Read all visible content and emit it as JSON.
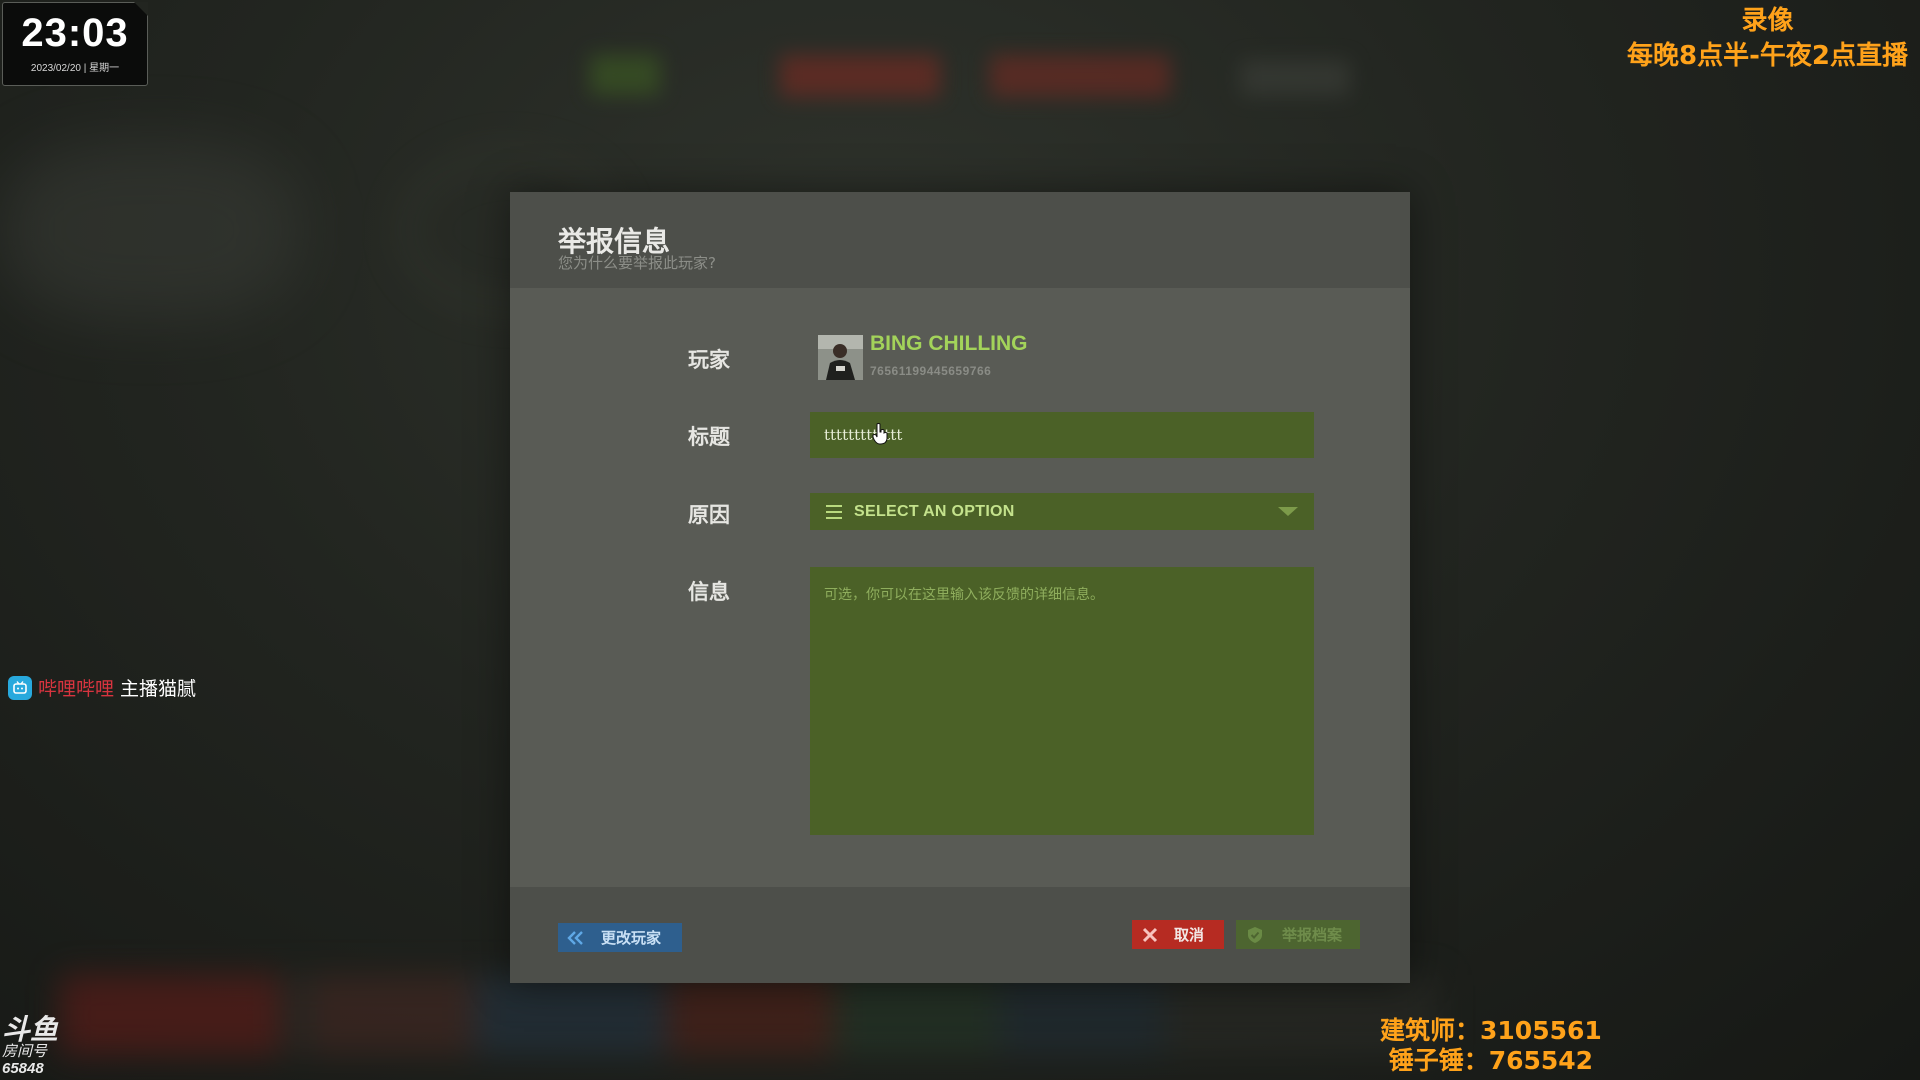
{
  "clock": {
    "time": "23:03",
    "date": "2023/02/20 | 星期一"
  },
  "stream_info": {
    "line1": "录像",
    "line2": "每晚8点半-午夜2点直播"
  },
  "bilibili": {
    "site": "哔哩哔哩",
    "streamer": "主播猫腻",
    "icon": "bilibili-tv-icon",
    "color": "#d8343f"
  },
  "douyu": {
    "logo": "斗鱼",
    "room_label": "房间号",
    "room_number": "65848"
  },
  "stats": {
    "architect_label": "建筑师：",
    "architect_value": "3105561",
    "hammer_label": "锤子锤：",
    "hammer_value": "765542"
  },
  "dialog": {
    "title": "举报信息",
    "subtitle": "您为什么要举报此玩家?",
    "labels": {
      "player": "玩家",
      "title": "标题",
      "reason": "原因",
      "info": "信息"
    },
    "player": {
      "name": "BING CHILLING",
      "steam_id": "76561199445659766"
    },
    "title_input": {
      "value": "ttttttttttttt"
    },
    "reason_select": {
      "selected": "SELECT AN OPTION",
      "icon": "menu-lines-icon"
    },
    "info_textarea": {
      "placeholder": "可选，你可以在这里输入该反馈的详细信息。",
      "value": ""
    },
    "buttons": {
      "change_player": "更改玩家",
      "cancel": "取消",
      "submit": "举报档案"
    }
  },
  "colors": {
    "accent_green": "#a3d35a",
    "field_green": "#4b6127",
    "danger_red": "#b62b22",
    "secondary_blue": "#2e5f8e",
    "overlay_orange": "#ffa21a"
  }
}
